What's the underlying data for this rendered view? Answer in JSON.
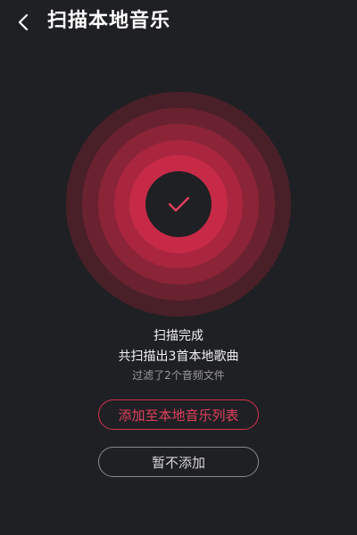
{
  "header": {
    "title": "扫描本地音乐",
    "back_icon": "chevron-left-icon"
  },
  "scan": {
    "status": "扫描完成",
    "result": "共扫描出3首本地歌曲",
    "filtered": "过滤了2个音频文件",
    "icon": "check-icon"
  },
  "actions": {
    "add_label": "添加至本地音乐列表",
    "skip_label": "暂不添加"
  },
  "colors": {
    "background": "#1f2023",
    "accent": "#d3314f",
    "ring_outer": "#4d2229",
    "ring_inner": "#c52744",
    "center": "#1f2023"
  }
}
